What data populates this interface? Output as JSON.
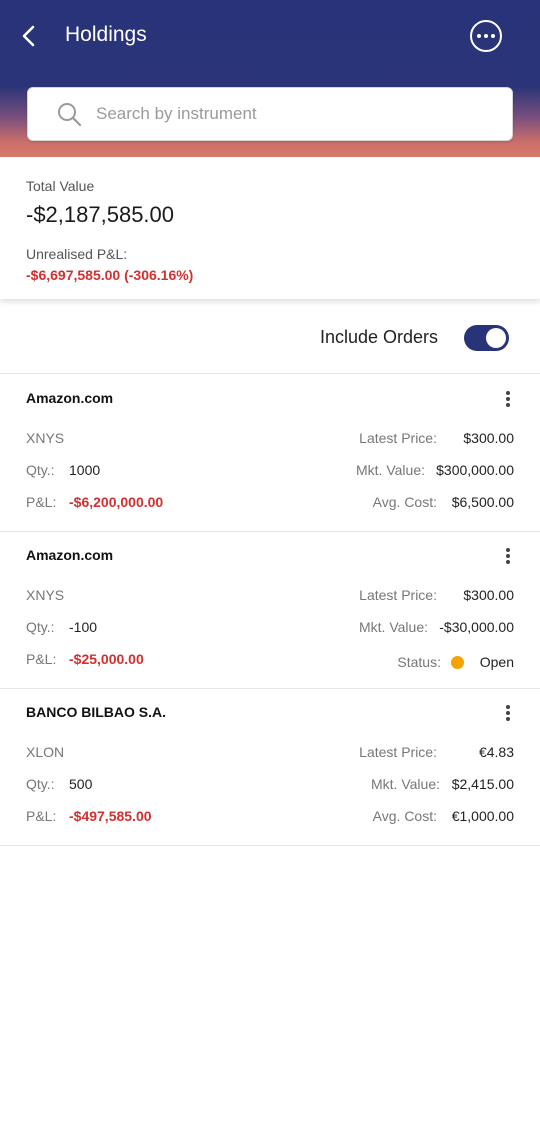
{
  "header": {
    "title": "Holdings",
    "search_placeholder": "Search by instrument"
  },
  "summary": {
    "total_label": "Total Value",
    "total_value": "-$2,187,585.00",
    "pnl_label": "Unrealised P&L:",
    "pnl_value": "-$6,697,585.00 (-306.16%)"
  },
  "orders": {
    "label": "Include Orders",
    "enabled": true
  },
  "holdings": [
    {
      "name": "Amazon.com",
      "exchange": "XNYS",
      "qty_label": "Qty.:",
      "qty": "1000",
      "pnl_label": "P&L:",
      "pnl": "-$6,200,000.00",
      "latest_price_label": "Latest Price:",
      "latest_price": "$300.00",
      "mkt_value_label": "Mkt. Value:",
      "mkt_value": "$300,000.00",
      "avg_cost_label": "Avg. Cost:",
      "avg_cost": "$6,500.00"
    },
    {
      "name": "Amazon.com",
      "exchange": "XNYS",
      "qty_label": "Qty.:",
      "qty": "-100",
      "pnl_label": "P&L:",
      "pnl": "-$25,000.00",
      "latest_price_label": "Latest Price:",
      "latest_price": "$300.00",
      "mkt_value_label": "Mkt. Value:",
      "mkt_value": "-$30,000.00",
      "status_label": "Status:",
      "status": "Open",
      "status_color": "#f5a300"
    },
    {
      "name": "BANCO BILBAO S.A.",
      "exchange": "XLON",
      "qty_label": "Qty.:",
      "qty": "500",
      "pnl_label": "P&L:",
      "pnl": "-$497,585.00",
      "latest_price_label": "Latest Price:",
      "latest_price": "€4.83",
      "mkt_value_label": "Mkt. Value:",
      "mkt_value": "$2,415.00",
      "avg_cost_label": "Avg. Cost:",
      "avg_cost": "€1,000.00"
    }
  ],
  "colors": {
    "brand": "#283379",
    "negative": "#d32f2f",
    "status_open": "#f5a300"
  },
  "icons": [
    "back-arrow-icon",
    "more-options-icon",
    "search-icon",
    "kebab-menu-icon"
  ]
}
